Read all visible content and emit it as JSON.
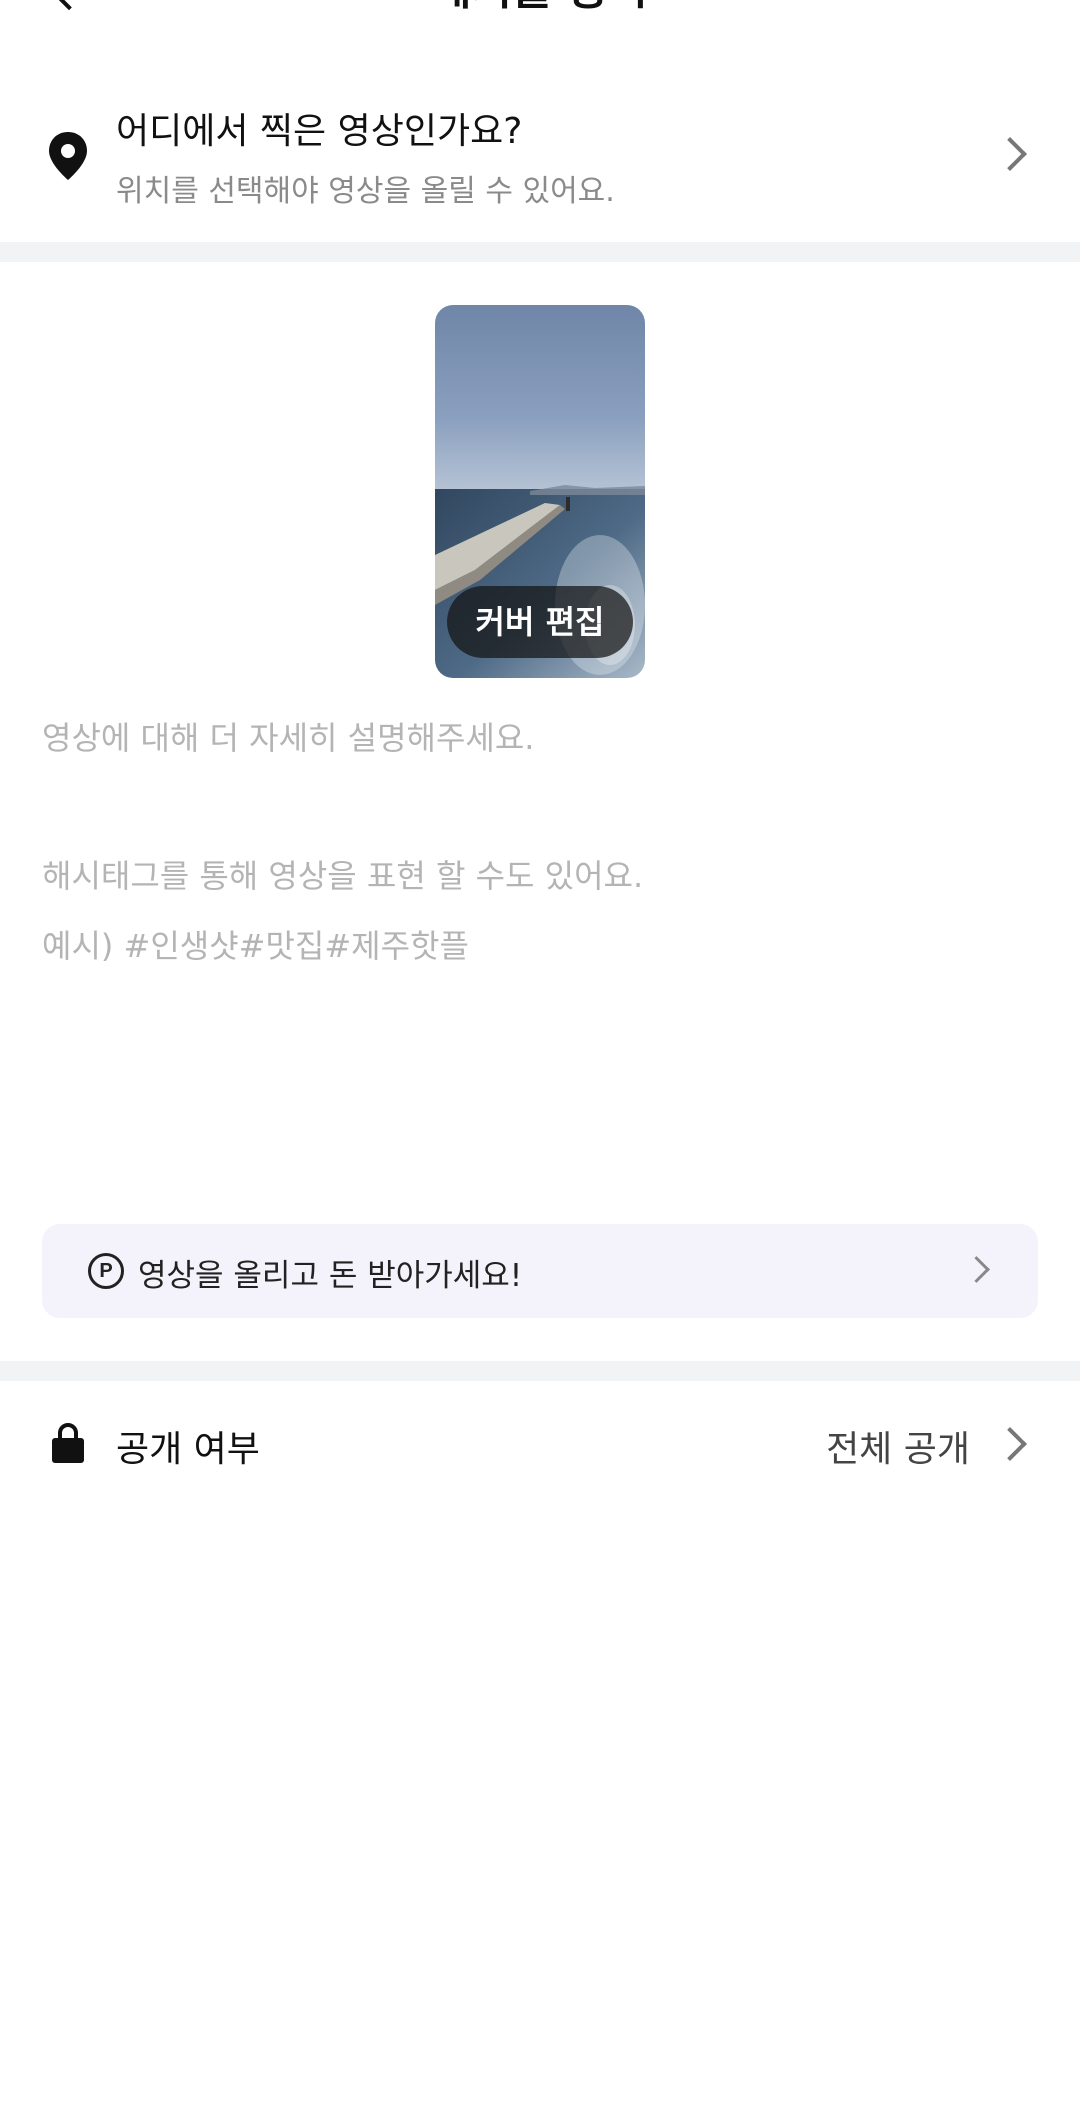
{
  "header": {
    "title": "게시물 등록"
  },
  "location": {
    "title": "어디에서 찍은 영상인가요?",
    "subtitle": "위치를 선택해야 영상을 올릴 수 있어요.",
    "icon": "location-pin-icon"
  },
  "cover": {
    "edit_label": "커버 편집"
  },
  "description": {
    "placeholder_line1": "영상에 대해 더 자세히 설명해주세요.",
    "placeholder_line2": "해시태그를 통해 영상을 표현 할 수도 있어요.",
    "placeholder_line3": "예시) #인생샷#맛집#제주핫플"
  },
  "reward_banner": {
    "icon_letter": "P",
    "text": "영상을 올리고 돈 받아가세요!"
  },
  "visibility": {
    "label": "공개 여부",
    "value": "전체 공개",
    "icon": "lock-icon"
  },
  "colors": {
    "divider": "#f2f3f5",
    "banner_bg": "#f4f2fb",
    "placeholder_text": "#b4b4b4",
    "secondary_text": "#8a8a8a"
  }
}
